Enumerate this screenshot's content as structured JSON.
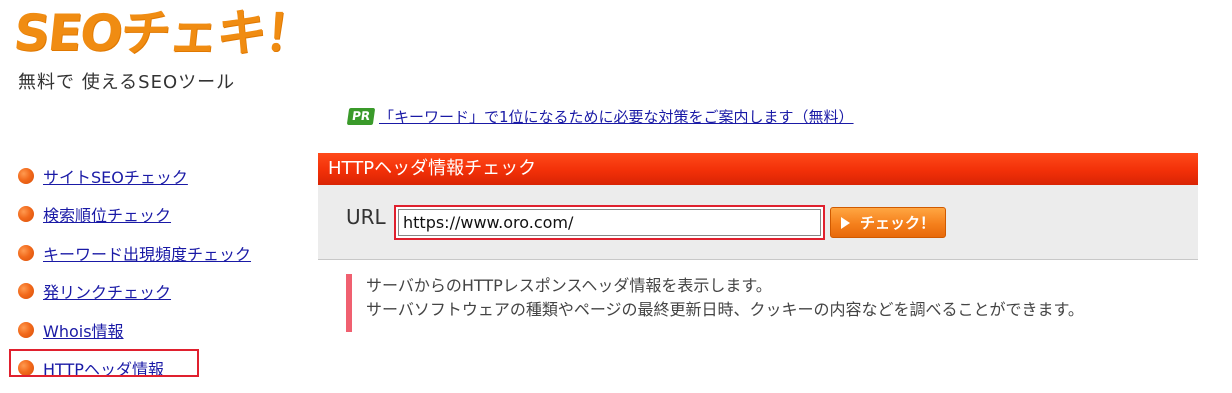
{
  "brand": {
    "logo_text": "SEOチェキ！",
    "tagline": "無料で 使えるSEOツール",
    "logo_color": "#f08c12"
  },
  "pr": {
    "badge": "PR",
    "link_text": "「キーワード」で1位になるために必要な対策をご案内します（無料）"
  },
  "sidebar": {
    "items": [
      {
        "label": "サイトSEOチェック",
        "icon": "orange-bullet-icon"
      },
      {
        "label": "検索順位チェック",
        "icon": "orange-bullet-icon"
      },
      {
        "label": "キーワード出現頻度チェック",
        "icon": "orange-bullet-icon"
      },
      {
        "label": "発リンクチェック",
        "icon": "orange-bullet-icon"
      },
      {
        "label": "Whois情報",
        "icon": "orange-bullet-icon"
      },
      {
        "label": "HTTPヘッダ情報",
        "icon": "orange-bullet-icon",
        "active": true
      }
    ]
  },
  "main": {
    "header_title": "HTTPヘッダ情報チェック",
    "url_label": "URL",
    "url_value": "https://www.oro.com/",
    "check_button_label": "チェック！",
    "description_lines": [
      "サーバからのHTTPレスポンスヘッダ情報を表示します。",
      "サーバソフトウェアの種類やページの最終更新日時、クッキーの内容などを調べることができます。"
    ]
  },
  "colors": {
    "header_red": "#f23008",
    "link_blue": "#1a1aa6",
    "highlight_red": "#e0202e",
    "button_orange": "#f5801c",
    "pr_green": "#3a9a2a",
    "desc_bar": "#f06070"
  }
}
